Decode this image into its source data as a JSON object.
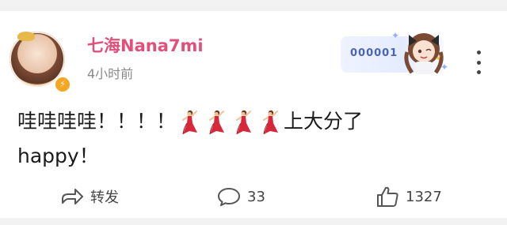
{
  "post": {
    "username": "七海Nana7mi",
    "time": "4小时前",
    "content_line1_prefix": "哇哇哇哇！！！！",
    "dancer_emoji_count": 4,
    "content_line1_suffix": "上大分了",
    "content_line2": "happy！",
    "fan_card_number": "000001"
  },
  "actions": {
    "repost_label": "转发",
    "comment_count": "33",
    "like_count": "1327"
  },
  "colors": {
    "username": "#e0507a",
    "fan_number": "#4a64b8",
    "avatar_badge": "#f5a623"
  },
  "icons": {
    "avatar_badge": "lightning-icon",
    "more": "more-vertical-icon",
    "repost": "repost-arrow-icon",
    "comment": "comment-bubble-icon",
    "like": "thumbs-up-icon",
    "emoji": "dancer-emoji-icon"
  }
}
